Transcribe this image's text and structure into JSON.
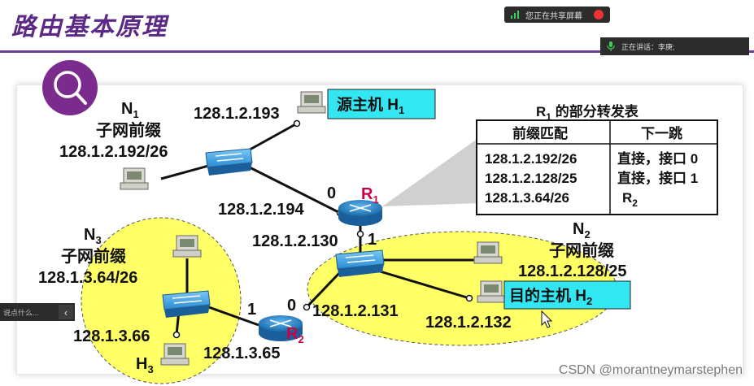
{
  "slide": {
    "title": "路由基本原理",
    "networks": {
      "n1": {
        "name": "N",
        "sub": "1",
        "label": "子网前缀",
        "prefix": "128.1.2.192/26"
      },
      "n2": {
        "name": "N",
        "sub": "2",
        "label": "子网前缀",
        "prefix": "128.1.2.128/25"
      },
      "n3": {
        "name": "N",
        "sub": "3",
        "label": "子网前缀",
        "prefix": "128.1.3.64/26"
      }
    },
    "ips": {
      "h1": "128.1.2.193",
      "r1_if0": "128.1.2.194",
      "r1_if1": "128.1.2.130",
      "r2_if0": "128.1.2.131",
      "h2": "128.1.2.132",
      "h3": "128.1.3.66",
      "r2_if1": "128.1.3.65"
    },
    "interfaces": {
      "r1_0": "0",
      "r1_1": "1",
      "r2_0": "0",
      "r2_1": "1"
    },
    "hosts": {
      "source": {
        "text": "源主机 H",
        "sub": "1"
      },
      "dest": {
        "text": "目的主机 H",
        "sub": "2"
      },
      "h3": {
        "text": "H",
        "sub": "3"
      }
    },
    "routers": {
      "r1": {
        "text": "R",
        "sub": "1"
      },
      "r2": {
        "text": "R",
        "sub": "2"
      }
    },
    "table": {
      "title_r": "R",
      "title_sub": "1",
      "title_rest": " 的部分转发表",
      "headers": [
        "前缀匹配",
        "下一跳"
      ],
      "rows": [
        [
          "128.1.2.192/26",
          "直接，接口 0"
        ],
        [
          "128.1.2.128/25",
          "直接，接口 1"
        ],
        [
          "128.1.3.64/26",
          "R"
        ]
      ],
      "row3_sub": "2"
    }
  },
  "meeting": {
    "share_status": "您正在共享屏幕",
    "speaking_label": "正在讲话：李庚;",
    "chat_placeholder": "说点什么...",
    "chat_toggle": "‹"
  },
  "watermark": "CSDN @morantneymarstephen",
  "colors": {
    "accent": "#5b2a86",
    "host_box": "#32e6f2",
    "network_fill": "#ffff66",
    "router": "#2a7fc1",
    "router_label": "#cc0044"
  }
}
